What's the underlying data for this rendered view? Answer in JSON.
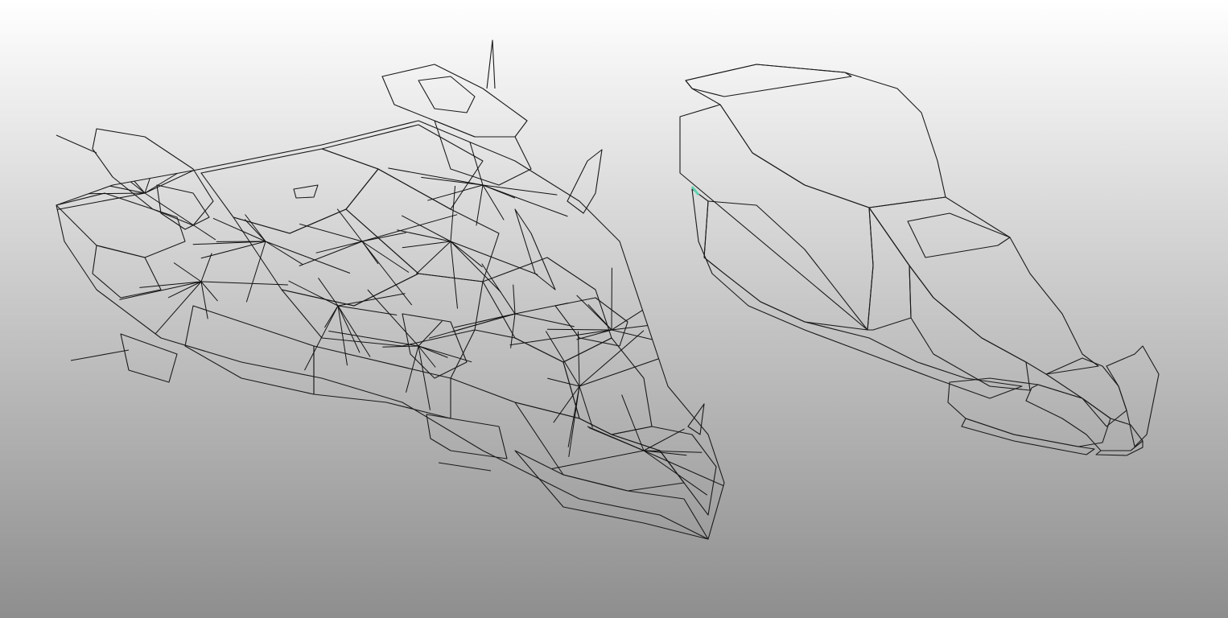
{
  "viewport": {
    "background_top": "#ffffff",
    "background_bottom": "#8e8e8e",
    "objects": [
      {
        "icon": "wireframe-ship-model",
        "shading": "wireframe"
      },
      {
        "icon": "collision-hull-model",
        "shading": "flat"
      }
    ]
  },
  "colors": {
    "ship_face_light": "#c4c4c4",
    "ship_face_mid": "#9a9a9a",
    "ship_face_dark": "#6f6f6f",
    "ship_face_highlight": "#e4dcdc",
    "hull_top": "#a9a9a9",
    "hull_side_dark": "#676767",
    "hull_side_mid": "#8c8c8c",
    "hull_light": "#c9c9c9",
    "hull_trim": "#ece4e6",
    "selection_highlight": "#c9c400",
    "selection_edge": "#e9e600",
    "accent_teal": "#5fd2b0"
  }
}
